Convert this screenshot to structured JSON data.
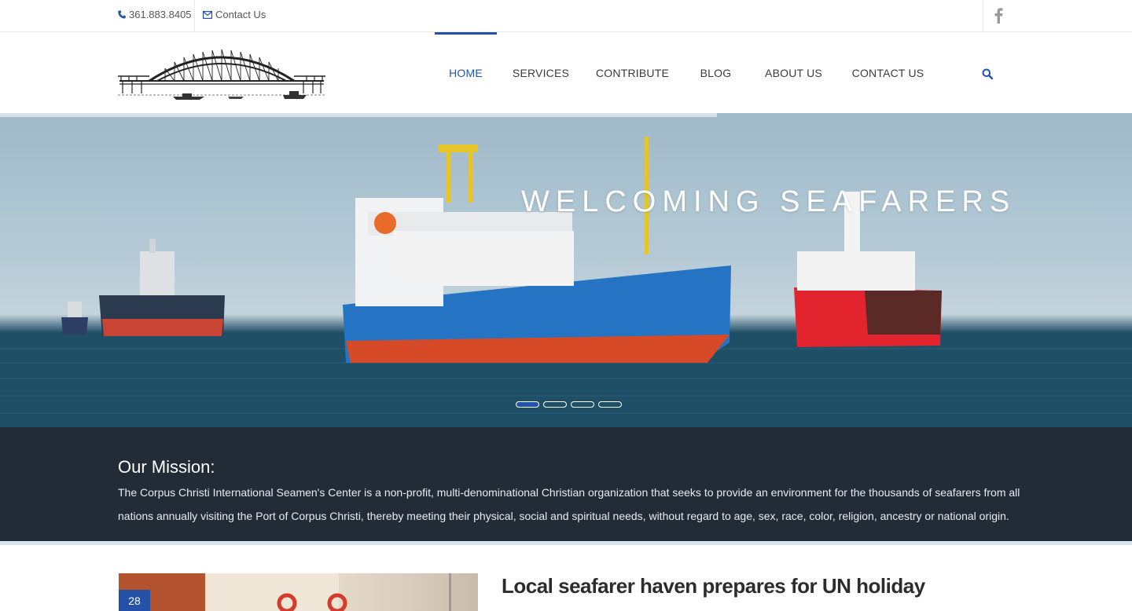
{
  "topbar": {
    "phone": "361.883.8405",
    "contact_label": "Contact Us",
    "icons": [
      "phone-icon",
      "envelope-icon",
      "facebook-icon"
    ]
  },
  "nav": {
    "items": [
      {
        "label": "HOME",
        "active": true
      },
      {
        "label": "SERVICES",
        "active": false
      },
      {
        "label": "CONTRIBUTE",
        "active": false
      },
      {
        "label": "BLOG",
        "active": false
      },
      {
        "label": "ABOUT US",
        "active": false
      },
      {
        "label": "CONTACT US",
        "active": false
      }
    ],
    "search_icon": "search-icon"
  },
  "hero": {
    "title": "WELCOMING SEAFARERS",
    "slides": 4,
    "active_slide": 1
  },
  "mission": {
    "heading": "Our Mission:",
    "text": "The Corpus Christi International Seamen's Center is a non-profit, multi-denominational Christian organization that seeks to provide an environment for the thousands of seafarers from all nations annually visiting the Port of Corpus Christi, thereby meeting their physical, social and spiritual needs, without regard to age, sex, race, color, religion, ancestry or national origin."
  },
  "post": {
    "day": "28",
    "title": "Local seafarer haven prepares for UN holiday"
  },
  "colors": {
    "accent": "#2452a8",
    "mission_bg": "#222c37"
  }
}
